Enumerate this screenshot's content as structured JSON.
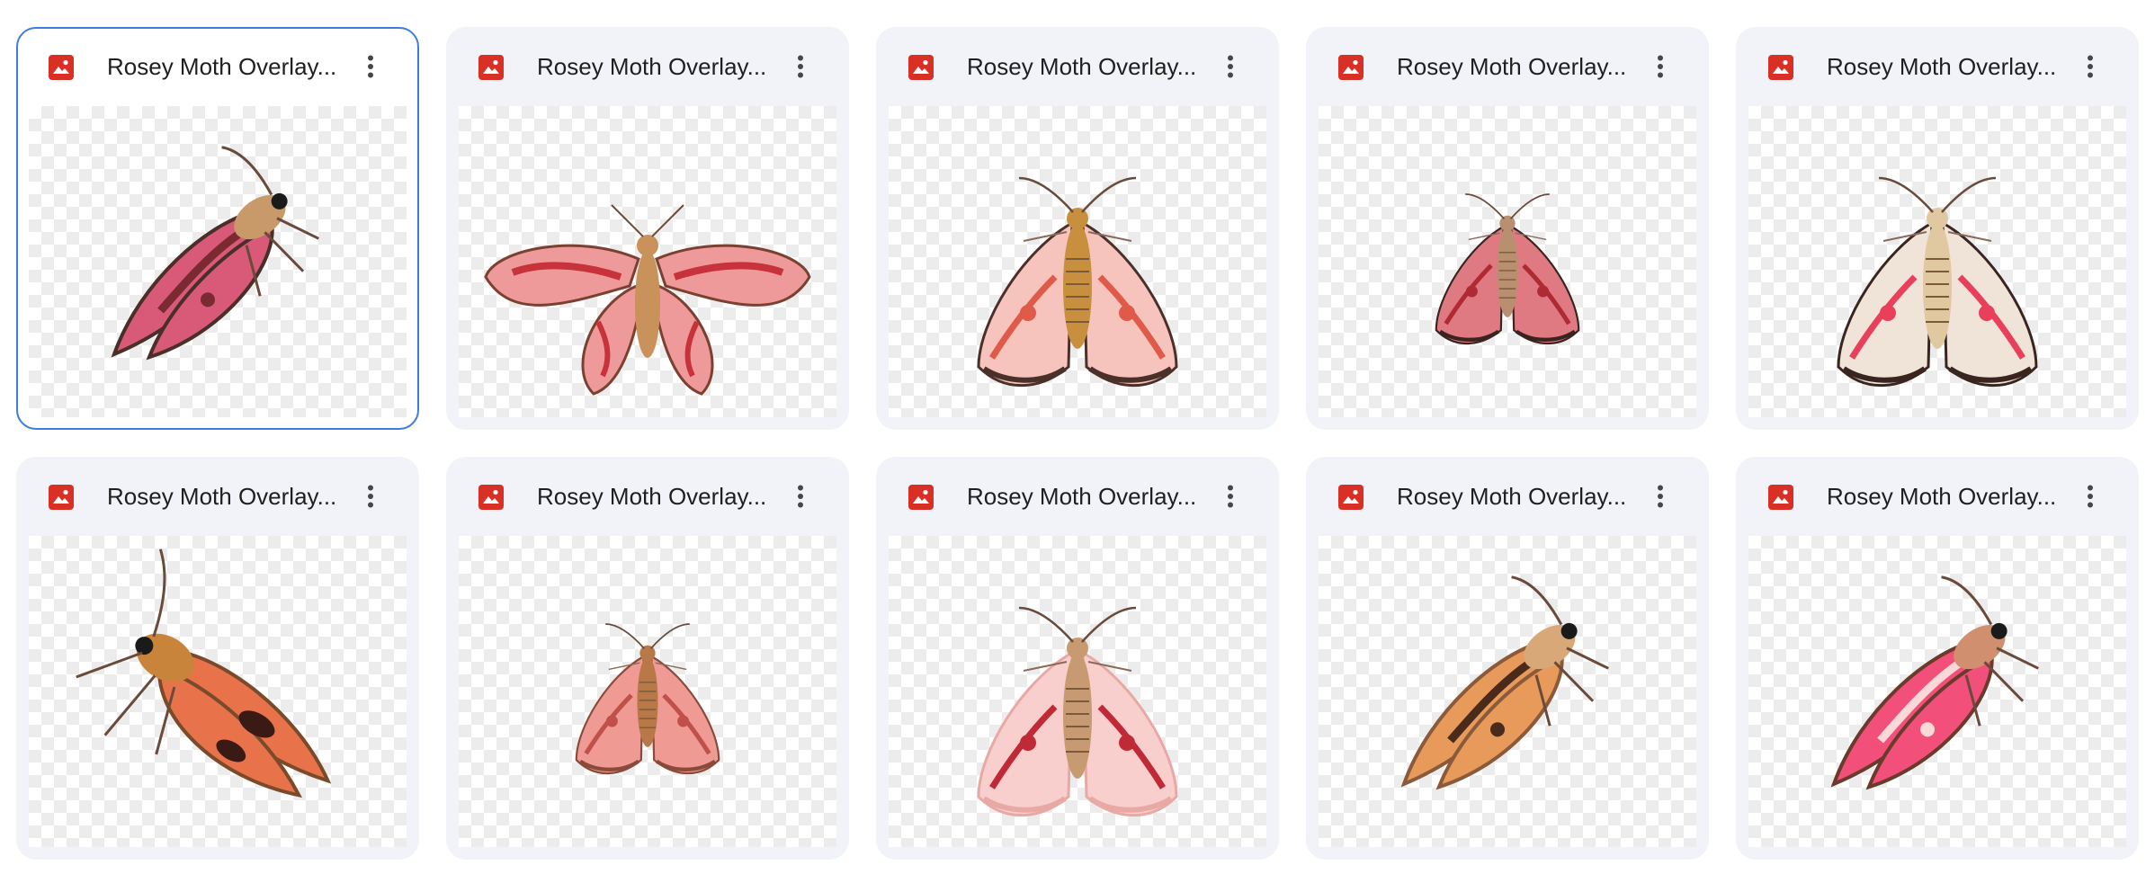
{
  "files": [
    {
      "name": "Rosey Moth Overlay...",
      "selected": true,
      "file_icon": "image-file-icon",
      "more_icon": "more-vert-icon",
      "pose": "side-left",
      "colors": {
        "wing": "#d85a78",
        "accent": "#7a2a30",
        "edge": "#4a2e28",
        "body": "#c89a6a"
      }
    },
    {
      "name": "Rosey Moth Overlay...",
      "selected": false,
      "file_icon": "image-file-icon",
      "more_icon": "more-vert-icon",
      "pose": "spread",
      "colors": {
        "wing": "#ef9a9a",
        "accent": "#c8323a",
        "edge": "#7a4030",
        "body": "#c8925a"
      }
    },
    {
      "name": "Rosey Moth Overlay...",
      "selected": false,
      "file_icon": "image-file-icon",
      "more_icon": "more-vert-icon",
      "pose": "folded",
      "colors": {
        "wing": "#f6c4bc",
        "accent": "#e05a4a",
        "edge": "#4a3028",
        "body": "#c8903e"
      }
    },
    {
      "name": "Rosey Moth Overlay...",
      "selected": false,
      "file_icon": "image-file-icon",
      "more_icon": "more-vert-icon",
      "pose": "folded-small",
      "colors": {
        "wing": "#e07a82",
        "accent": "#b02a34",
        "edge": "#3a2420",
        "body": "#b89070"
      }
    },
    {
      "name": "Rosey Moth Overlay...",
      "selected": false,
      "file_icon": "image-file-icon",
      "more_icon": "more-vert-icon",
      "pose": "folded",
      "colors": {
        "wing": "#f0e4d8",
        "accent": "#e8405a",
        "edge": "#3a2420",
        "body": "#e0c8a0"
      }
    },
    {
      "name": "Rosey Moth Overlay...",
      "selected": false,
      "file_icon": "image-file-icon",
      "more_icon": "more-vert-icon",
      "pose": "side-right",
      "colors": {
        "wing": "#e8734a",
        "accent": "#3a1a14",
        "edge": "#7a4a2a",
        "body": "#c8843a"
      }
    },
    {
      "name": "Rosey Moth Overlay...",
      "selected": false,
      "file_icon": "image-file-icon",
      "more_icon": "more-vert-icon",
      "pose": "folded-small",
      "colors": {
        "wing": "#f09a94",
        "accent": "#c0504a",
        "edge": "#8a4a3a",
        "body": "#b87848"
      }
    },
    {
      "name": "Rosey Moth Overlay...",
      "selected": false,
      "file_icon": "image-file-icon",
      "more_icon": "more-vert-icon",
      "pose": "folded",
      "colors": {
        "wing": "#f8cfcc",
        "accent": "#c02a36",
        "edge": "#e8a8a4",
        "body": "#c89a72"
      }
    },
    {
      "name": "Rosey Moth Overlay...",
      "selected": false,
      "file_icon": "image-file-icon",
      "more_icon": "more-vert-icon",
      "pose": "side-left",
      "colors": {
        "wing": "#e89a5a",
        "accent": "#4a2a1a",
        "edge": "#8a5a3a",
        "body": "#d8a878"
      }
    },
    {
      "name": "Rosey Moth Overlay...",
      "selected": false,
      "file_icon": "image-file-icon",
      "more_icon": "more-vert-icon",
      "pose": "side-left",
      "colors": {
        "wing": "#f2507a",
        "accent": "#f8d8d8",
        "edge": "#6a3a2a",
        "body": "#d09070"
      }
    }
  ]
}
